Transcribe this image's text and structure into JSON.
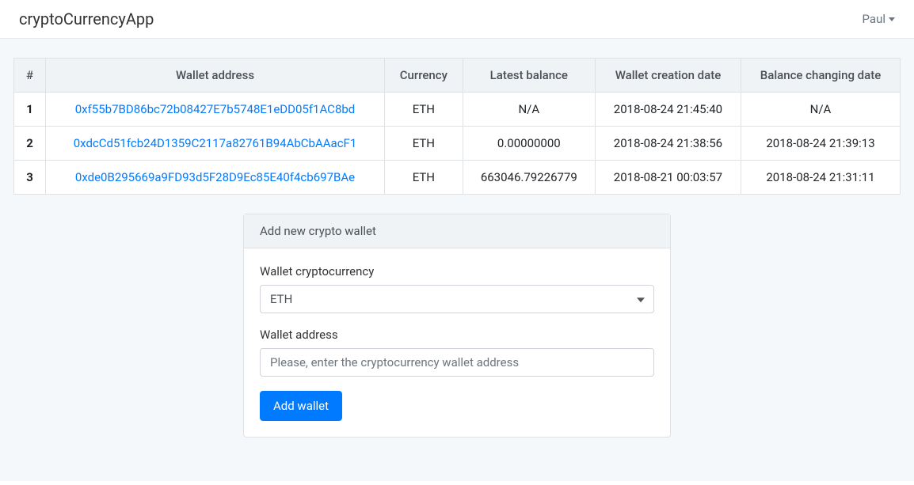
{
  "navbar": {
    "brand": "cryptoCurrencyApp",
    "user_name": "Paul"
  },
  "table": {
    "headers": {
      "index": "#",
      "address": "Wallet address",
      "currency": "Currency",
      "balance": "Latest balance",
      "created": "Wallet creation date",
      "changed": "Balance changing date"
    },
    "rows": [
      {
        "index": "1",
        "address": "0xf55b7BD86bc72b08427E7b5748E1eDD05f1AC8bd",
        "currency": "ETH",
        "balance": "N/A",
        "created": "2018-08-24 21:45:40",
        "changed": "N/A"
      },
      {
        "index": "2",
        "address": "0xdcCd51fcb24D1359C2117a82761B94AbCbAAacF1",
        "currency": "ETH",
        "balance": "0.00000000",
        "created": "2018-08-24 21:38:56",
        "changed": "2018-08-24 21:39:13"
      },
      {
        "index": "3",
        "address": "0xde0B295669a9FD93d5F28D9Ec85E40f4cb697BAe",
        "currency": "ETH",
        "balance": "663046.79226779",
        "created": "2018-08-21 00:03:57",
        "changed": "2018-08-24 21:31:11"
      }
    ]
  },
  "form": {
    "title": "Add new crypto wallet",
    "currency_label": "Wallet cryptocurrency",
    "currency_value": "ETH",
    "address_label": "Wallet address",
    "address_placeholder": "Please, enter the cryptocurrency wallet address",
    "submit_label": "Add wallet"
  }
}
